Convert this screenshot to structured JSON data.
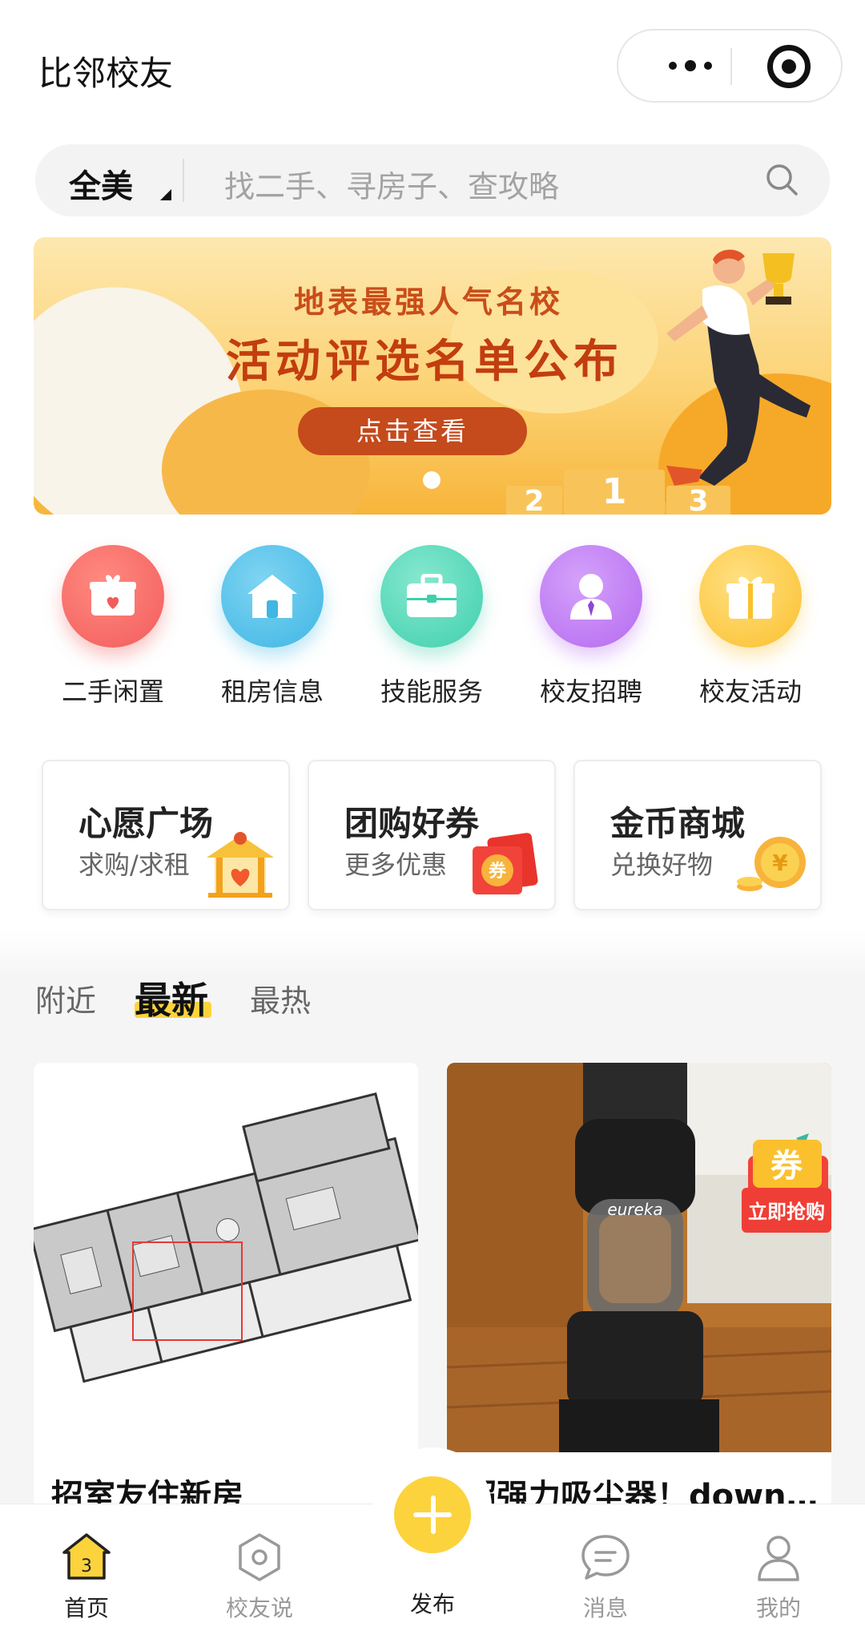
{
  "header": {
    "title": "比邻校友"
  },
  "search": {
    "region": "全美",
    "placeholder": "找二手、寻房子、查攻略"
  },
  "banner": {
    "subtitle": "地表最强人气名校",
    "title": "活动评选名单公布",
    "cta": "点击查看",
    "podium": [
      "2",
      "1",
      "3"
    ]
  },
  "categories": [
    {
      "label": "二手闲置",
      "icon": "gift-box-icon",
      "color": "#f25c5c"
    },
    {
      "label": "租房信息",
      "icon": "house-icon",
      "color": "#3fb6e4"
    },
    {
      "label": "技能服务",
      "icon": "briefcase-icon",
      "color": "#3fcfad"
    },
    {
      "label": "校友招聘",
      "icon": "person-tie-icon",
      "color": "#b569f0"
    },
    {
      "label": "校友活动",
      "icon": "gift-icon",
      "color": "#fbc02d"
    }
  ],
  "cards": [
    {
      "title": "心愿广场",
      "subtitle": "求购/求租",
      "icon": "wish-house-icon"
    },
    {
      "title": "团购好券",
      "subtitle": "更多优惠",
      "icon": "red-coupon-icon"
    },
    {
      "title": "金币商城",
      "subtitle": "兑换好物",
      "icon": "gold-coin-icon"
    }
  ],
  "tabs": [
    "附近",
    "最新",
    "最热"
  ],
  "active_tab": "最新",
  "feed": [
    {
      "title": "招室友住新房",
      "image": "floor-plan"
    },
    {
      "title": "超强力吸尘器！downt…",
      "image": "vacuum-cleaner"
    }
  ],
  "coupon_badge": {
    "top": "券",
    "bottom": "立即抢购"
  },
  "nav": [
    {
      "label": "首页",
      "icon": "home-icon",
      "active": true
    },
    {
      "label": "校友说",
      "icon": "hexagon-icon",
      "active": false
    },
    {
      "label": "发布",
      "icon": "plus-icon",
      "active": false
    },
    {
      "label": "消息",
      "icon": "chat-bubble-icon",
      "active": false
    },
    {
      "label": "我的",
      "icon": "user-icon",
      "active": false
    }
  ],
  "colors": {
    "accent": "#fcd33c",
    "banner_text": "#c23d0f"
  }
}
